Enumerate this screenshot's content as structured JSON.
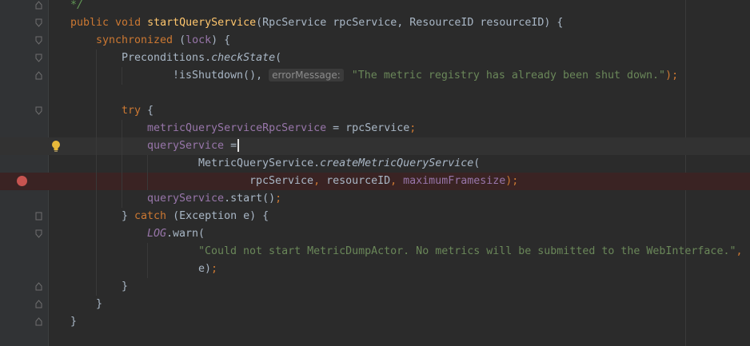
{
  "editor": {
    "lines": [
      {
        "id": "l0",
        "tokens": [
          {
            "t": "*/",
            "c": "cmt"
          }
        ],
        "indent": 0,
        "off": 6
      },
      {
        "id": "l1",
        "tokens": [
          {
            "t": "public ",
            "c": "kw"
          },
          {
            "t": "void ",
            "c": "kw"
          },
          {
            "t": "startQueryService",
            "c": "fn"
          },
          {
            "t": "(RpcService rpcService, ResourceID resourceID) {",
            "c": ""
          }
        ]
      },
      {
        "id": "l2",
        "tokens": [
          {
            "t": "synchronized ",
            "c": "kw"
          },
          {
            "t": "(",
            "c": ""
          },
          {
            "t": "lock",
            "c": "fld"
          },
          {
            "t": ") {",
            "c": ""
          }
        ]
      },
      {
        "id": "l3",
        "tokens": [
          {
            "t": "Preconditions.",
            "c": ""
          },
          {
            "t": "checkState",
            "c": "ital"
          },
          {
            "t": "(",
            "c": ""
          }
        ]
      },
      {
        "id": "l4",
        "tokens": [
          {
            "t": "!isShutdown(), ",
            "c": ""
          },
          {
            "t": "errorMessage:",
            "c": "hint"
          },
          {
            "t": " \"The metric registry has already been shut down.\"",
            "c": "str"
          },
          {
            "t": ");",
            "c": "kw"
          }
        ]
      },
      {
        "id": "l5",
        "tokens": []
      },
      {
        "id": "l6",
        "tokens": [
          {
            "t": "try ",
            "c": "kw"
          },
          {
            "t": "{",
            "c": ""
          }
        ]
      },
      {
        "id": "l7",
        "tokens": [
          {
            "t": "metricQueryServiceRpcService",
            "c": "fld"
          },
          {
            "t": " = rpcService",
            "c": ""
          },
          {
            "t": ";",
            "c": "kw"
          }
        ]
      },
      {
        "id": "l8",
        "tokens": [
          {
            "t": "queryService",
            "c": "fld"
          },
          {
            "t": " =",
            "c": ""
          },
          {
            "t": "",
            "c": "caret"
          }
        ]
      },
      {
        "id": "l9",
        "tokens": [
          {
            "t": "MetricQueryService.",
            "c": ""
          },
          {
            "t": "createMetricQueryService",
            "c": "ital"
          },
          {
            "t": "(",
            "c": ""
          }
        ]
      },
      {
        "id": "l10",
        "tokens": [
          {
            "t": "rpcService",
            "c": ""
          },
          {
            "t": ", ",
            "c": "kw"
          },
          {
            "t": "resourceID",
            "c": ""
          },
          {
            "t": ", ",
            "c": "kw"
          },
          {
            "t": "maximumFramesize",
            "c": "fld"
          },
          {
            "t": ");",
            "c": "kw"
          }
        ]
      },
      {
        "id": "l11",
        "tokens": [
          {
            "t": "queryService",
            "c": "fld"
          },
          {
            "t": ".start()",
            "c": ""
          },
          {
            "t": ";",
            "c": "kw"
          }
        ]
      },
      {
        "id": "l12",
        "tokens": [
          {
            "t": "} ",
            "c": ""
          },
          {
            "t": "catch ",
            "c": "kw"
          },
          {
            "t": "(Exception e) {",
            "c": ""
          }
        ]
      },
      {
        "id": "l13",
        "tokens": [
          {
            "t": "LOG",
            "c": "static-fld"
          },
          {
            "t": ".warn(",
            "c": ""
          }
        ]
      },
      {
        "id": "l14",
        "tokens": [
          {
            "t": "\"Could not start MetricDumpActor. No metrics will be submitted to the WebInterface.\"",
            "c": "str"
          },
          {
            "t": ",",
            "c": "kw"
          }
        ]
      },
      {
        "id": "l15",
        "tokens": [
          {
            "t": "e)",
            "c": ""
          },
          {
            "t": ";",
            "c": "kw"
          }
        ]
      },
      {
        "id": "l16",
        "tokens": [
          {
            "t": "}",
            "c": ""
          }
        ]
      },
      {
        "id": "l17",
        "tokens": [
          {
            "t": "}",
            "c": ""
          }
        ]
      },
      {
        "id": "l18",
        "tokens": [
          {
            "t": "}",
            "c": ""
          }
        ]
      }
    ]
  },
  "gutter": {
    "fold_icon": "fold-marker-icon",
    "bulb_icon": "lightbulb-icon",
    "breakpoint_icon": "breakpoint-icon"
  },
  "colors": {
    "background": "#2b2b2b",
    "keyword": "#cc7832",
    "method": "#ffc66d",
    "field": "#9876aa",
    "string": "#6a8759",
    "text": "#a9b7c6",
    "breakpoint": "#c75450"
  }
}
